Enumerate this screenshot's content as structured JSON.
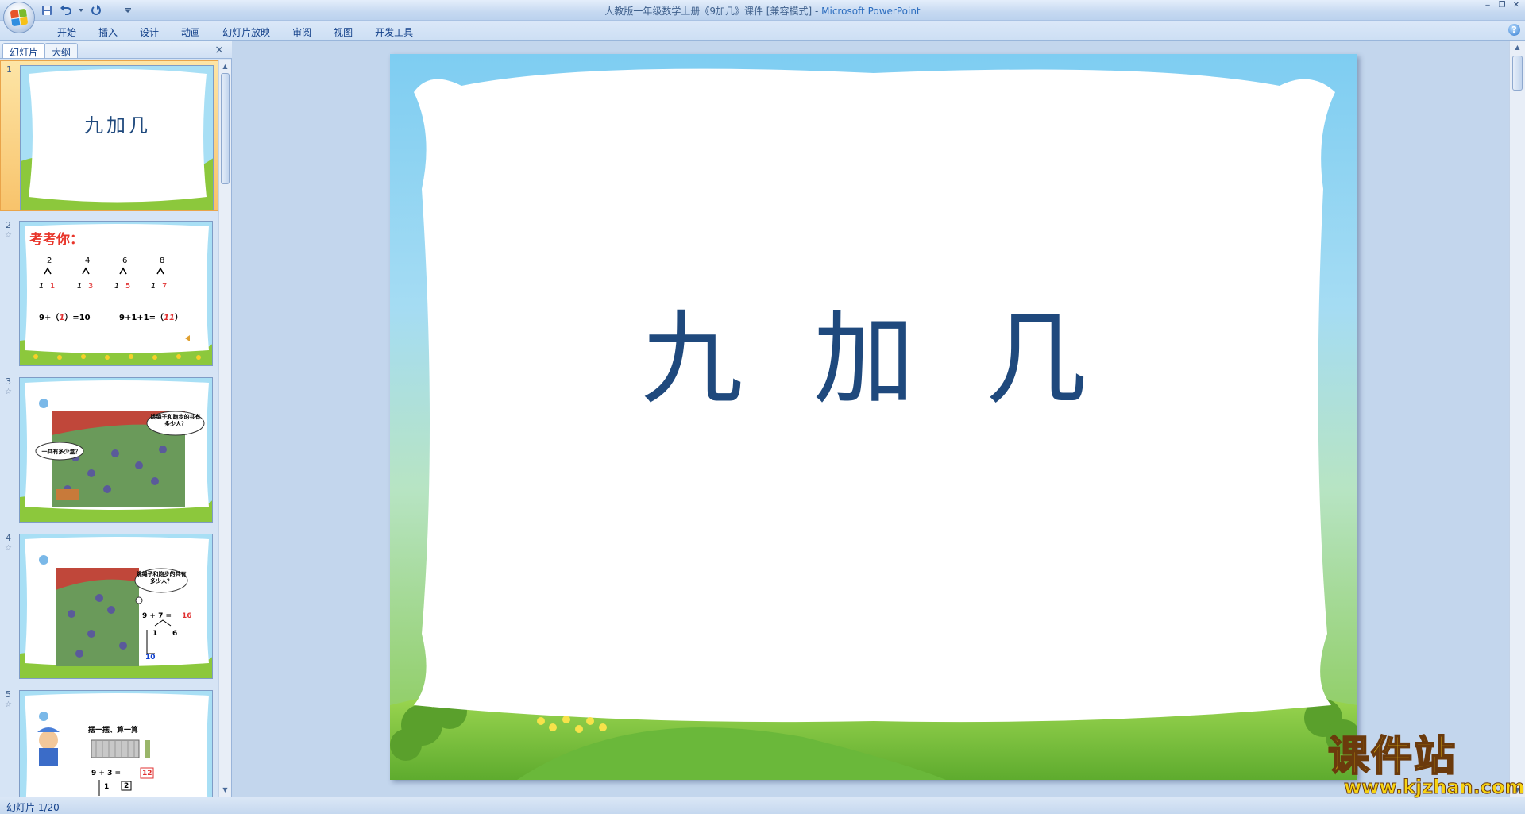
{
  "window": {
    "title": "人教版一年级数学上册《9加几》课件 [兼容模式] - ",
    "app_name": "Microsoft PowerPoint",
    "controls": [
      "‒",
      "❐",
      "✕"
    ]
  },
  "quick_access": [
    "save-icon",
    "undo-icon",
    "redo-icon",
    "customize-icon"
  ],
  "ribbon": {
    "tabs": [
      "开始",
      "插入",
      "设计",
      "动画",
      "幻灯片放映",
      "审阅",
      "视图",
      "开发工具"
    ],
    "help": "?"
  },
  "pane": {
    "tabs": [
      "幻灯片",
      "大纲"
    ],
    "close": "×"
  },
  "slides": [
    {
      "number": "1",
      "title": "九加几"
    },
    {
      "number": "2",
      "title": "考考你：",
      "tops": [
        "2",
        "4",
        "6",
        "8"
      ],
      "bottoms_left": [
        "1",
        "1",
        "1",
        "1"
      ],
      "bottoms_right": [
        "1",
        "3",
        "5",
        "7"
      ],
      "eq1_a": "9+（",
      "eq1_b": "1",
      "eq1_c": "）=10",
      "eq2_a": "9+1+1=（",
      "eq2_b": "11",
      "eq2_c": "）"
    },
    {
      "number": "3",
      "bubble1": "一共有多少盒？",
      "bubble2": "跳绳子和跑步的共有多少人？"
    },
    {
      "number": "4",
      "bubble": "跳绳子和跑步的共有多少人？",
      "eq": "9 + 7 =",
      "result": "16",
      "split_a": "1",
      "split_b": "6",
      "sum": "10"
    },
    {
      "number": "5",
      "heading": "摆一摆、算一算",
      "eq": "9 + 3 =",
      "result": "12",
      "split_a": "1",
      "split_b": "2"
    }
  ],
  "main_slide": {
    "title": "九 加 几"
  },
  "status": {
    "text": "幻灯片 1/20"
  },
  "watermark": {
    "main": "课件站",
    "url": "www.kjzhan.com"
  },
  "colors": {
    "title_blue": "#1f497d",
    "sky_blue": "#8fd3f4",
    "grass_green": "#8cc83c",
    "accent_red": "#e03030"
  }
}
